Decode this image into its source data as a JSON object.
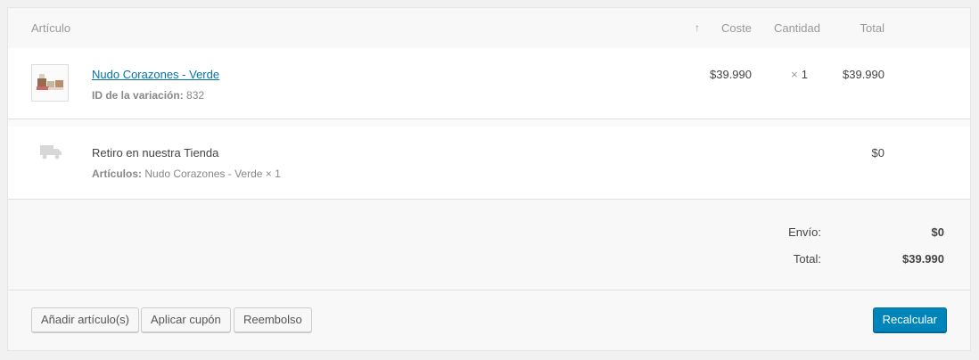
{
  "header": {
    "item": "Artículo",
    "sort_icon": "↑",
    "cost": "Coste",
    "quantity": "Cantidad",
    "total": "Total"
  },
  "item": {
    "name": "Nudo Corazones - Verde",
    "variation_label": "ID de la variación:",
    "variation_id": "832",
    "cost": "$39.990",
    "qty_symbol": "×",
    "qty": "1",
    "total": "$39.990"
  },
  "shipping": {
    "name": "Retiro en nuestra Tienda",
    "items_label": "Artículos:",
    "items_value": "Nudo Corazones - Verde × 1",
    "cost": "$0"
  },
  "totals": {
    "shipping_label": "Envío:",
    "shipping_value": "$0",
    "total_label": "Total:",
    "total_value": "$39.990"
  },
  "actions": {
    "add_item": "Añadir artículo(s)",
    "apply_coupon": "Aplicar cupón",
    "refund": "Reembolso",
    "recalculate": "Recalcular"
  },
  "colors": {
    "link": "#0073aa",
    "primary_button": "#0085ba"
  }
}
